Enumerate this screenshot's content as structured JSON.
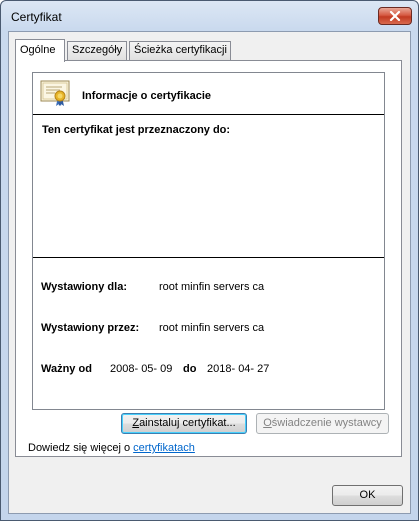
{
  "window": {
    "title": "Certyfikat"
  },
  "tabs": [
    {
      "label": "Ogólne",
      "active": true
    },
    {
      "label": "Szczegóły",
      "active": false
    },
    {
      "label": "Ścieżka certyfikacji",
      "active": false
    }
  ],
  "certificate": {
    "info_title": "Informacje o certyfikacie",
    "purpose_heading": "Ten certyfikat jest przeznaczony do:",
    "issued_to_label": "Wystawiony dla:",
    "issued_to_value": "root minfin servers ca",
    "issued_by_label": "Wystawiony przez:",
    "issued_by_value": "root minfin servers ca",
    "valid_from_label": "Ważny od",
    "valid_from_value": "2008- 05- 09",
    "valid_to_label": "do",
    "valid_to_value": "2018- 04- 27"
  },
  "buttons": {
    "install": {
      "mnemonic": "Z",
      "rest": "ainstaluj certyfikat..."
    },
    "issuer_statement": {
      "mnemonic": "O",
      "rest": "świadczenie wystawcy"
    },
    "ok": "OK"
  },
  "learn_more": {
    "prefix": "Dowiedz się więcej o ",
    "link": "certyfikatach"
  },
  "icons": {
    "certificate": "certificate-icon",
    "close": "close-icon"
  },
  "colors": {
    "link": "#0066cc",
    "close_button": "#c7432a"
  }
}
